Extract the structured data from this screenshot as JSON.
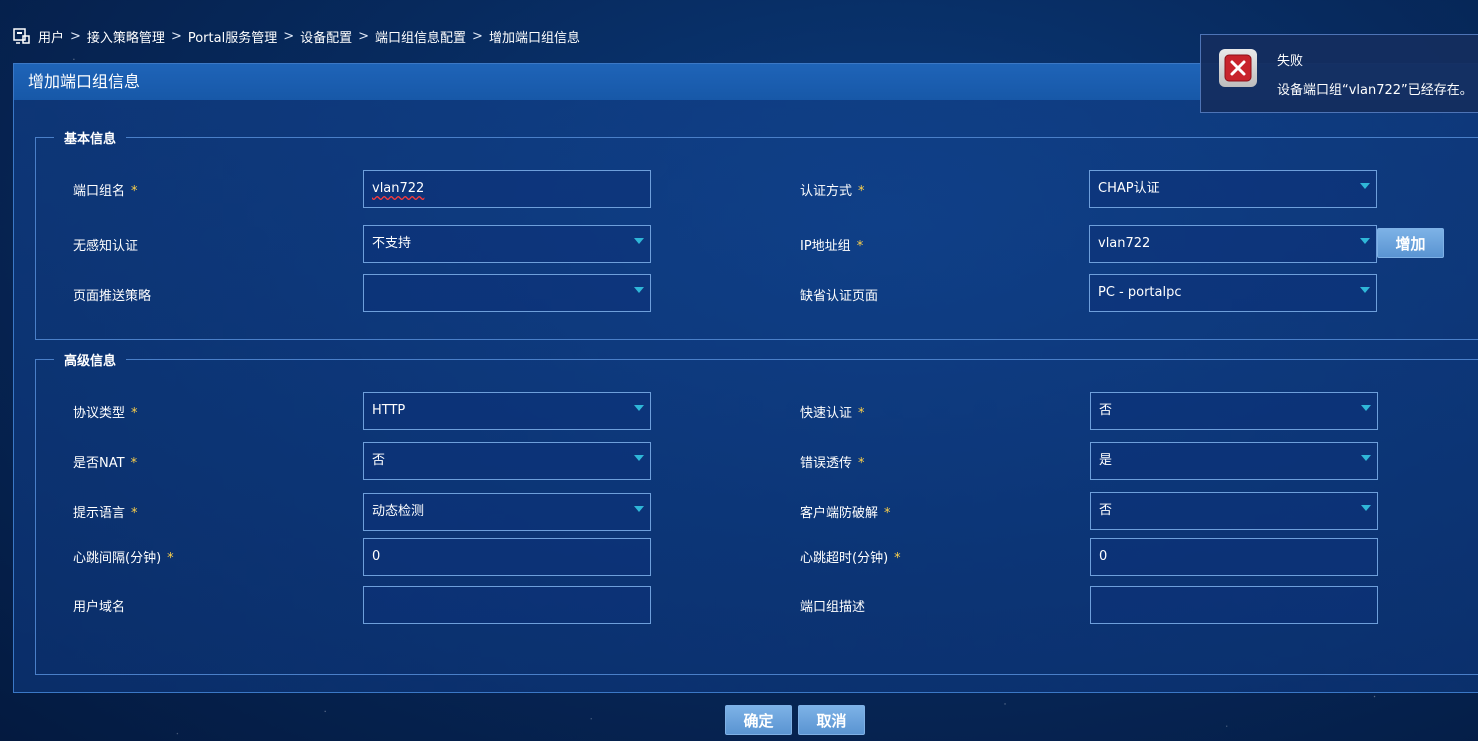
{
  "breadcrumb": {
    "items": [
      "用户",
      "接入策略管理",
      "Portal服务管理",
      "设备配置",
      "端口组信息配置"
    ],
    "current": "增加端口组信息",
    "separator": ">"
  },
  "panel": {
    "title": "增加端口组信息"
  },
  "basic": {
    "legend": "基本信息",
    "port_group_name": {
      "label": "端口组名",
      "value": "vlan722",
      "required": "*"
    },
    "auth_method": {
      "label": "认证方式",
      "value": "CHAP认证",
      "required": "*"
    },
    "seamless_auth": {
      "label": "无感知认证",
      "value": "不支持"
    },
    "ip_group": {
      "label": "IP地址组",
      "value": "vlan722",
      "required": "*",
      "add_label": "增加"
    },
    "push_policy": {
      "label": "页面推送策略",
      "value": ""
    },
    "default_page": {
      "label": "缺省认证页面",
      "value": "PC - portalpc"
    }
  },
  "advanced": {
    "legend": "高级信息",
    "protocol": {
      "label": "协议类型",
      "value": "HTTP",
      "required": "*"
    },
    "fast_auth": {
      "label": "快速认证",
      "value": "否",
      "required": "*"
    },
    "nat": {
      "label": "是否NAT",
      "value": "否",
      "required": "*"
    },
    "error_passthrough": {
      "label": "错误透传",
      "value": "是",
      "required": "*"
    },
    "language": {
      "label": "提示语言",
      "value": "动态检测",
      "required": "*"
    },
    "anti_crack": {
      "label": "客户端防破解",
      "value": "否",
      "required": "*"
    },
    "heartbeat_interval": {
      "label": "心跳间隔(分钟)",
      "value": "0",
      "required": "*"
    },
    "heartbeat_timeout": {
      "label": "心跳超时(分钟)",
      "value": "0",
      "required": "*"
    },
    "user_domain": {
      "label": "用户域名",
      "value": ""
    },
    "description": {
      "label": "端口组描述",
      "value": ""
    }
  },
  "actions": {
    "ok": "确定",
    "cancel": "取消"
  },
  "toast": {
    "title": "失败",
    "message": "设备端口组“vlan722”已经存在。"
  },
  "colors": {
    "accent": "#1f64b8",
    "required": "#ffd24a",
    "caret": "#2fb7d8",
    "error": "#c8242c"
  },
  "icons": {
    "breadcrumb": "portal-icon",
    "toast": "error-close-icon",
    "select": "chevron-down-icon"
  }
}
